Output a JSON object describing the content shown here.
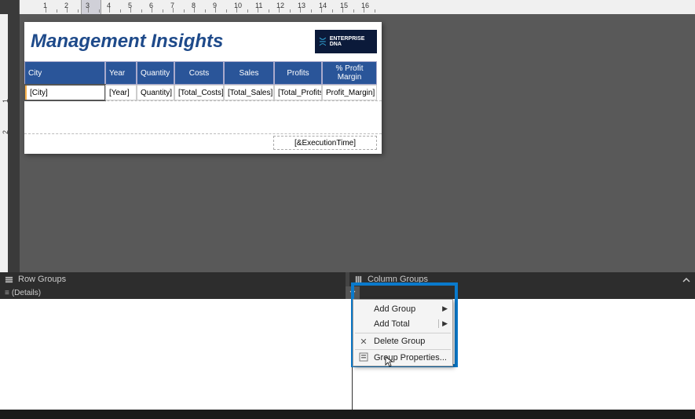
{
  "domain": "Computer-Use",
  "ruler": {
    "numbers": [
      1,
      2,
      3,
      4,
      5,
      6,
      7,
      8,
      9,
      10,
      11,
      12,
      13,
      14,
      15,
      16
    ]
  },
  "report": {
    "title": "Management Insights",
    "logo_text": "ENTERPRISE DNA",
    "columns": [
      {
        "header": "City",
        "field": "[City]"
      },
      {
        "header": "Year",
        "field": "[Year]"
      },
      {
        "header": "Quantity",
        "field": "Quantity]"
      },
      {
        "header": "Costs",
        "field": "[Total_Costs]"
      },
      {
        "header": "Sales",
        "field": "[Total_Sales]"
      },
      {
        "header": "Profits",
        "field": "[Total_Profits]"
      },
      {
        "header": "% Profit Margin",
        "field": "Profit_Margin]"
      }
    ],
    "footer_field": "[&ExecutionTime]"
  },
  "groups_panel": {
    "row_groups_label": "Row Groups",
    "column_groups_label": "Column Groups",
    "details_item": "(Details)"
  },
  "context_menu": {
    "items": [
      {
        "label": "Add Group",
        "submenu": true
      },
      {
        "label": "Add Total",
        "submenu": true
      },
      {
        "label": "Delete Group",
        "icon": "x"
      },
      {
        "label": "Group Properties...",
        "icon": "props"
      }
    ]
  }
}
